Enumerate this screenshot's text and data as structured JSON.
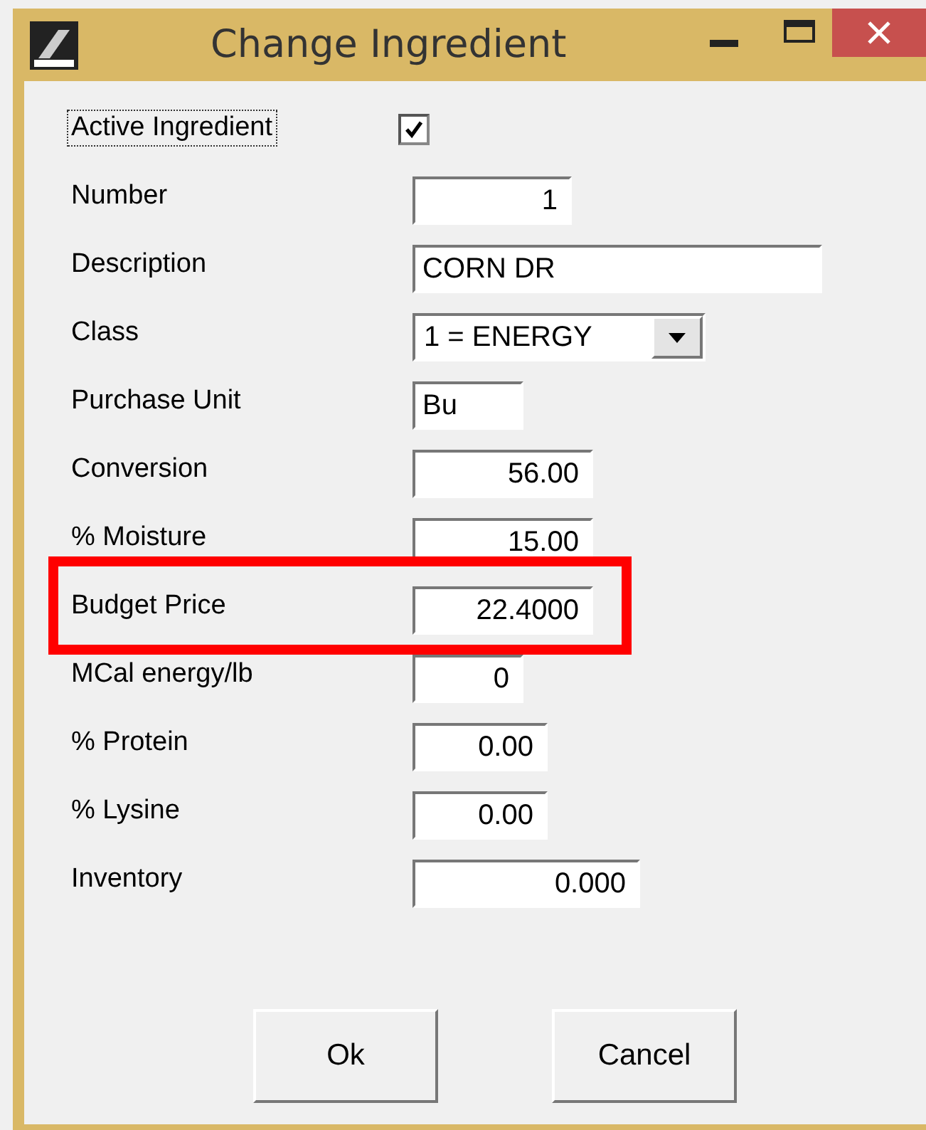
{
  "window": {
    "title": "Change Ingredient"
  },
  "fields": [
    {
      "kind": "checkbox",
      "label": "Active Ingredient",
      "checked": true,
      "focused": true
    },
    {
      "kind": "number",
      "label": "Number",
      "value": "1"
    },
    {
      "kind": "text",
      "label": "Description",
      "value": "CORN DR"
    },
    {
      "kind": "dropdown",
      "label": "Class",
      "value": "1 = ENERGY"
    },
    {
      "kind": "text",
      "label": "Purchase Unit",
      "value": "Bu"
    },
    {
      "kind": "number",
      "label": "Conversion",
      "value": "56.00"
    },
    {
      "kind": "number",
      "label": "% Moisture",
      "value": "15.00"
    },
    {
      "kind": "number",
      "label": "Budget Price",
      "value": "22.4000",
      "highlighted": true
    },
    {
      "kind": "number",
      "label": "MCal energy/lb",
      "value": "0"
    },
    {
      "kind": "number",
      "label": "% Protein",
      "value": "0.00"
    },
    {
      "kind": "number",
      "label": "% Lysine",
      "value": "0.00"
    },
    {
      "kind": "number",
      "label": "Inventory",
      "value": "0.000"
    }
  ],
  "buttons": [
    "Ok",
    "Cancel"
  ]
}
